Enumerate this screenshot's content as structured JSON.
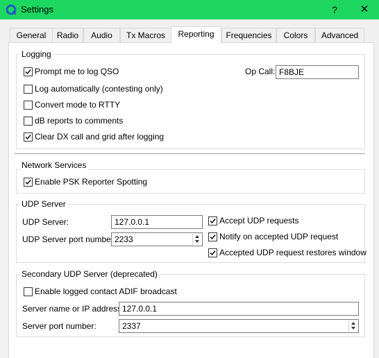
{
  "window": {
    "title": "Settings",
    "help": "?",
    "close": "✕",
    "accent": "#1ed760"
  },
  "tabs": [
    {
      "label": "General"
    },
    {
      "label": "Radio"
    },
    {
      "label": "Audio"
    },
    {
      "label": "Tx Macros"
    },
    {
      "label": "Reporting",
      "active": true
    },
    {
      "label": "Frequencies"
    },
    {
      "label": "Colors"
    },
    {
      "label": "Advanced"
    }
  ],
  "logging": {
    "title": "Logging",
    "prompt_log_qso": {
      "label": "Prompt me to log QSO",
      "checked": true
    },
    "log_auto": {
      "label": "Log automatically (contesting only)",
      "checked": false
    },
    "convert_rtty": {
      "label": "Convert mode to RTTY",
      "checked": false
    },
    "db_reports": {
      "label": "dB reports to comments",
      "checked": false
    },
    "clear_dx": {
      "label": "Clear DX call and grid after logging",
      "checked": true
    },
    "op_call_label": "Op Call:",
    "op_call_value": "F8BJE"
  },
  "network": {
    "title": "Network Services",
    "psk_reporter": {
      "label": "Enable PSK Reporter Spotting",
      "checked": true
    }
  },
  "udp": {
    "title": "UDP Server",
    "server_label": "UDP Server:",
    "server_value": "127.0.0.1",
    "port_label": "UDP Server port number:",
    "port_value": "2233",
    "accept": {
      "label": "Accept UDP requests",
      "checked": true
    },
    "notify": {
      "label": "Notify on accepted UDP request",
      "checked": true
    },
    "restore": {
      "label": "Accepted UDP request restores window",
      "checked": true
    }
  },
  "secondary_udp": {
    "title": "Secondary UDP Server (deprecated)",
    "adif_broadcast": {
      "label": "Enable logged contact ADIF broadcast",
      "checked": false
    },
    "server_label": "Server name or IP address:",
    "server_value": "127.0.0.1",
    "port_label": "Server port number:",
    "port_value": "2337"
  }
}
